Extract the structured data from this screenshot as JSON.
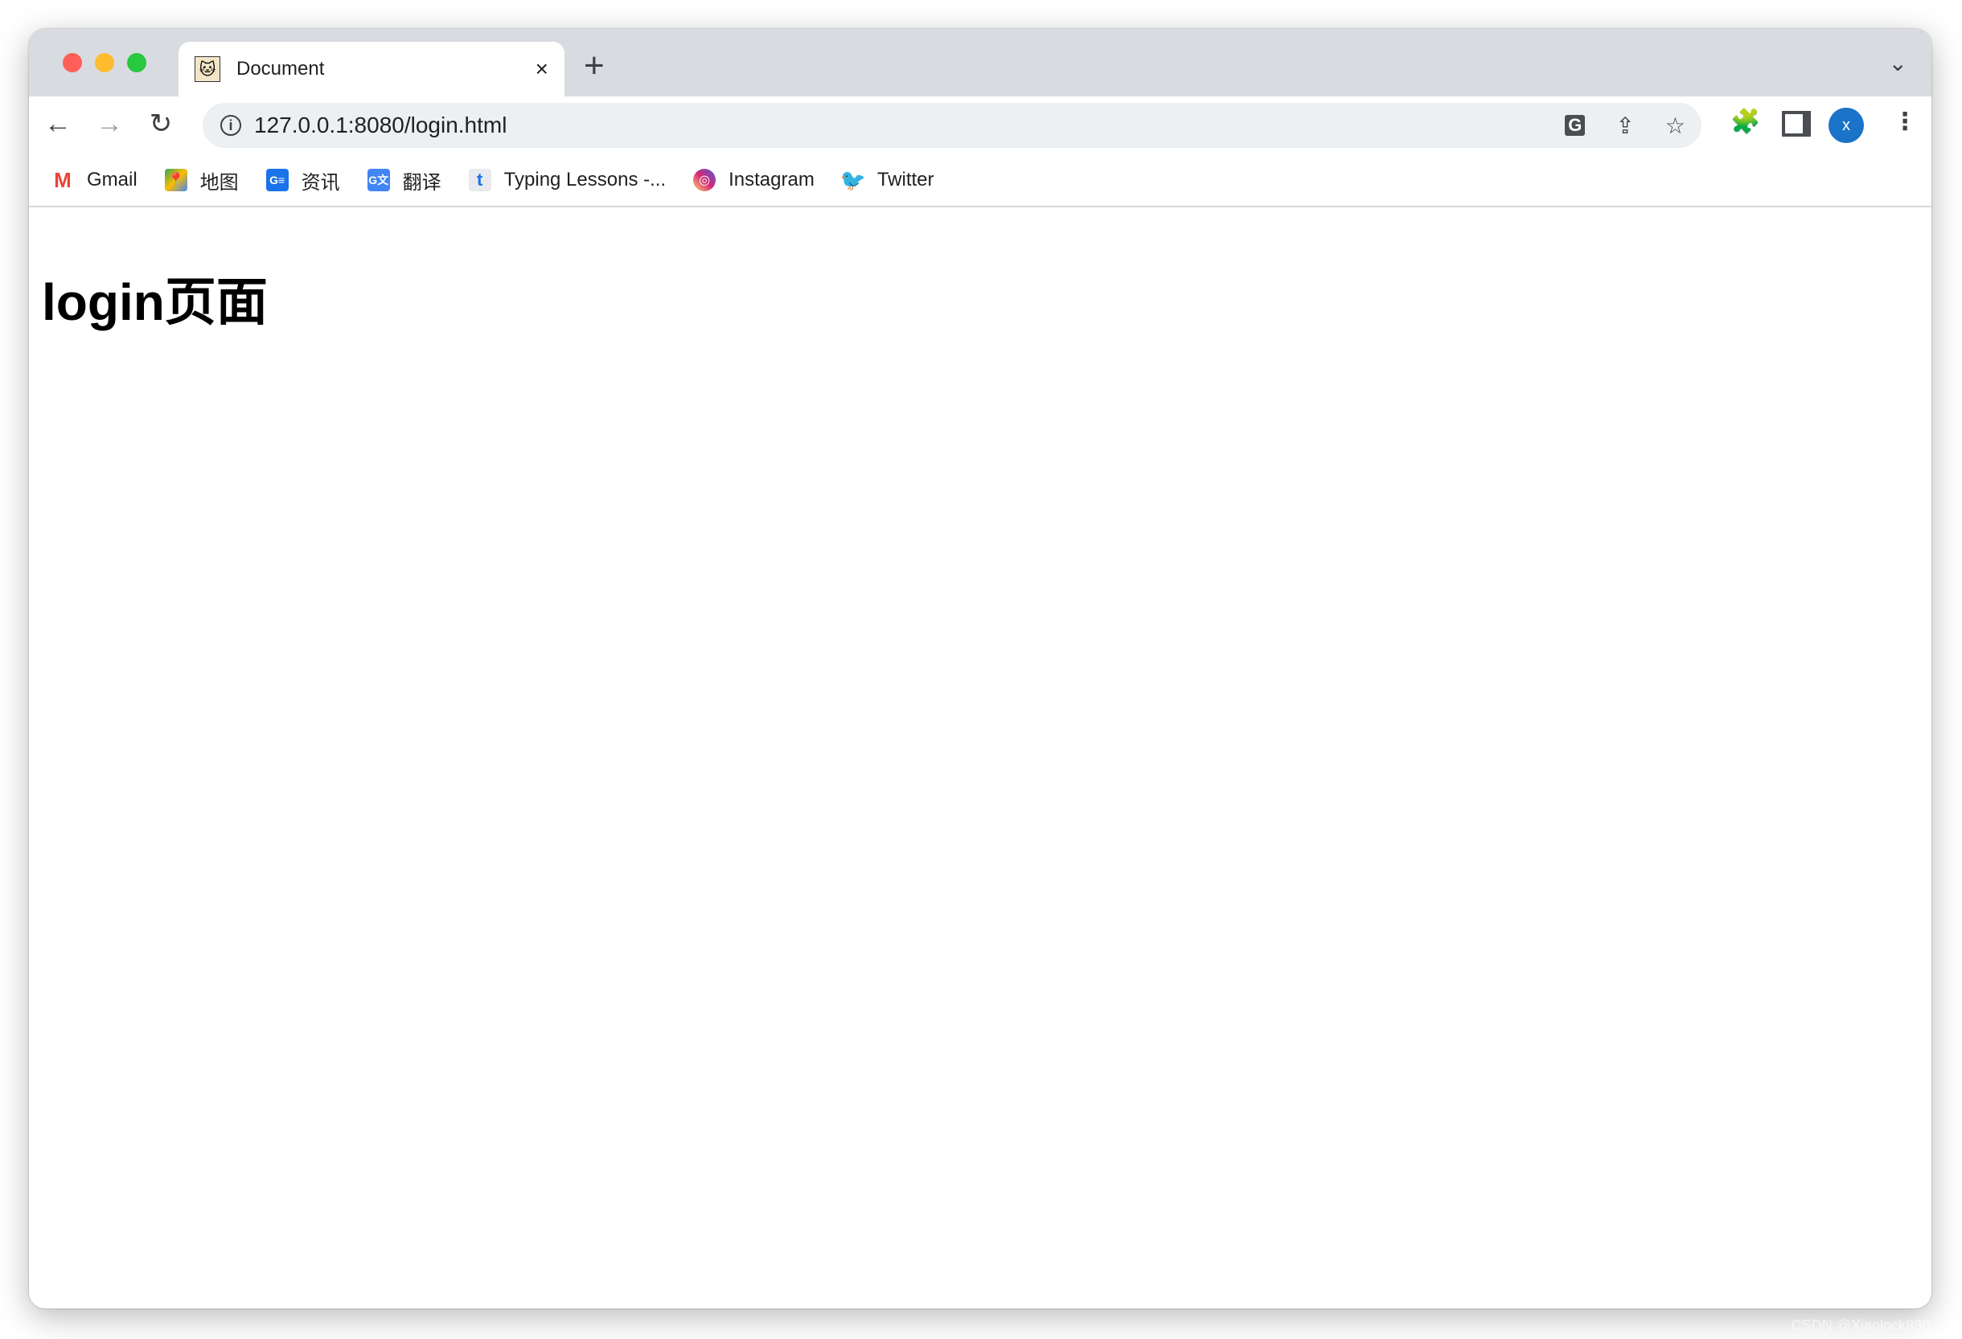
{
  "tab": {
    "title": "Document",
    "favicon": "tomcat-icon",
    "close": "×"
  },
  "new_tab": "+",
  "tab_search": "chevron-down-icon",
  "address_bar": {
    "url": "127.0.0.1:8080/login.html"
  },
  "profile": {
    "initial": "x",
    "color": "#1a73c8"
  },
  "bookmarks": [
    {
      "label": "Gmail",
      "icon": "gmail-icon"
    },
    {
      "label": "地图",
      "icon": "maps-icon"
    },
    {
      "label": "资讯",
      "icon": "news-icon"
    },
    {
      "label": "翻译",
      "icon": "translate-icon"
    },
    {
      "label": "Typing Lessons -...",
      "icon": "typing-icon"
    },
    {
      "label": "Instagram",
      "icon": "instagram-icon"
    },
    {
      "label": "Twitter",
      "icon": "twitter-icon"
    }
  ],
  "page": {
    "heading": "login页面"
  },
  "watermark": "CSDN @Xiaolock830"
}
